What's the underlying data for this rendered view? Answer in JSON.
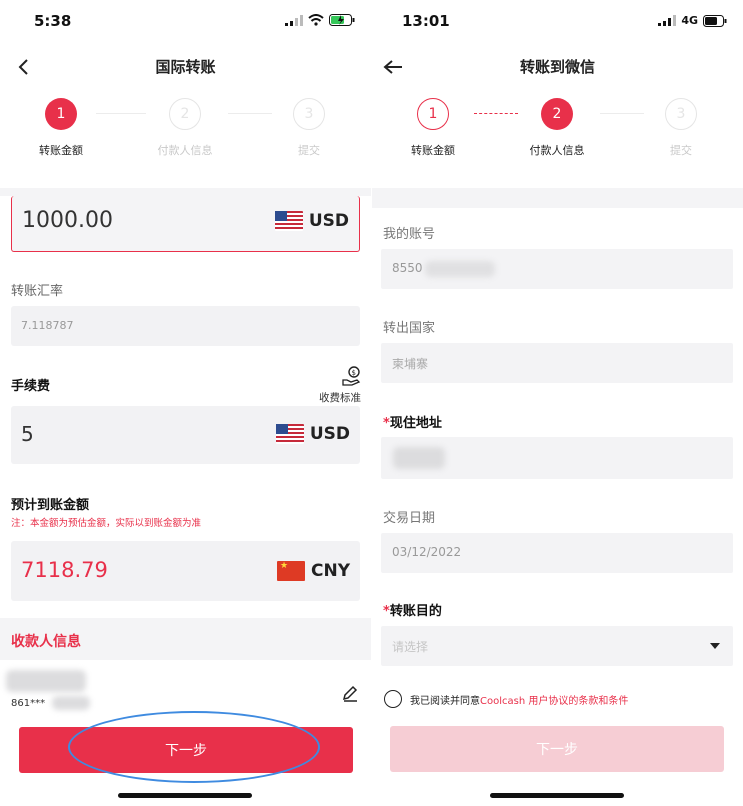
{
  "left": {
    "status": {
      "time": "5:38"
    },
    "nav": {
      "title": "国际转账"
    },
    "steps": [
      {
        "num": "1",
        "label": "转账金额",
        "state": "active"
      },
      {
        "num": "2",
        "label": "付款人信息",
        "state": "idle"
      },
      {
        "num": "3",
        "label": "提交",
        "state": "idle"
      }
    ],
    "amount": {
      "value": "1000.00",
      "currency": "USD"
    },
    "rate": {
      "label": "转账汇率",
      "value": "7.118787"
    },
    "fee": {
      "label": "手续费",
      "standard_label": "收费标准",
      "value": "5",
      "currency": "USD"
    },
    "estimated": {
      "label": "预计到账金额",
      "note": "注：本金额为预估金额，实际以到账金额为准",
      "value": "7118.79",
      "currency": "CNY"
    },
    "payee": {
      "title": "收款人信息",
      "account_partial": "861***"
    },
    "next_button": "下一步"
  },
  "right": {
    "status": {
      "time": "13:01",
      "network": "4G"
    },
    "nav": {
      "title": "转账到微信"
    },
    "steps": [
      {
        "num": "1",
        "label": "转账金额",
        "state": "done"
      },
      {
        "num": "2",
        "label": "付款人信息",
        "state": "active"
      },
      {
        "num": "3",
        "label": "提交",
        "state": "idle"
      }
    ],
    "fields": {
      "account": {
        "label": "我的账号",
        "value": "8550"
      },
      "country": {
        "label": "转出国家",
        "value": "柬埔寨"
      },
      "address": {
        "required": "*",
        "label": "现住地址",
        "value": ""
      },
      "date": {
        "label": "交易日期",
        "value": "03/12/2022"
      },
      "purpose": {
        "required": "*",
        "label": "转账目的",
        "placeholder": "请选择"
      }
    },
    "agreement": {
      "prefix": "我已阅读并同意",
      "link": "Coolcash 用户协议的条款和条件"
    },
    "next_button": "下一步"
  },
  "colors": {
    "accent": "#e8304a",
    "annotation": "#3f8be0"
  }
}
